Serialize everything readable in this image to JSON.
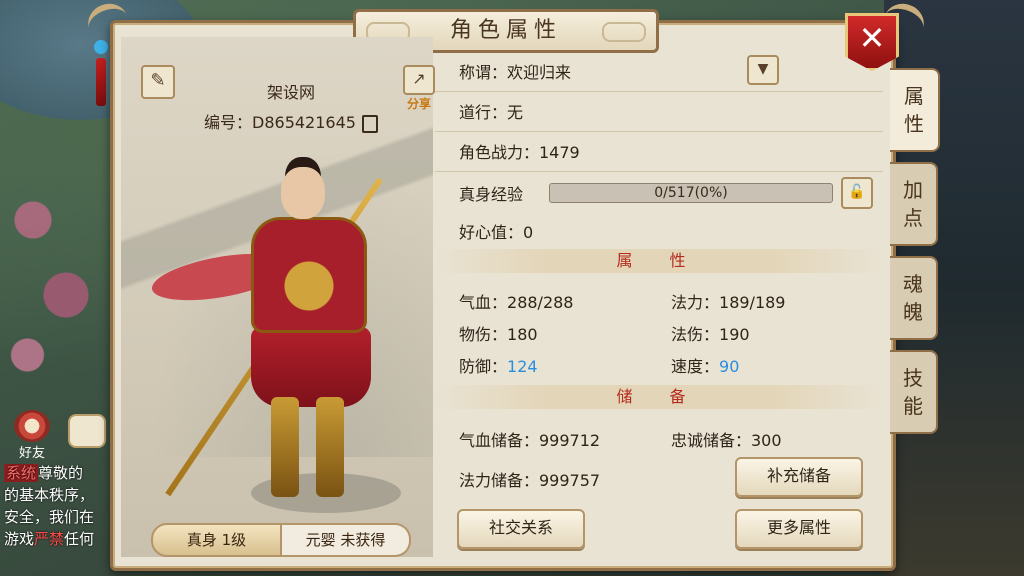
{
  "window": {
    "title": "角色属性"
  },
  "character": {
    "name": "架设网",
    "id_label": "编号：D865421645",
    "share_label": "分享",
    "realm_tabs": [
      {
        "label": "真身 1级",
        "active": true
      },
      {
        "label": "元婴 未获得",
        "active": false
      }
    ]
  },
  "info": {
    "title_row": "称谓：欢迎归来",
    "daoxing_row": "道行：无",
    "power_row": "角色战力：1479",
    "exp_label": "真身经验",
    "exp_text": "0/517(0%)",
    "exp_fraction": 0,
    "goodwill_row": "好心值：0"
  },
  "attributes": {
    "section_label": "属 性",
    "hp_label": "气血：",
    "hp_value": "288/288",
    "mp_label": "法力：",
    "mp_value": "189/189",
    "patk_label": "物伤：",
    "patk_value": "180",
    "matk_label": "法伤：",
    "matk_value": "190",
    "def_label": "防御：",
    "def_value": "124",
    "spd_label": "速度：",
    "spd_value": "90"
  },
  "reserves": {
    "section_label": "储 备",
    "hp_reserve": "气血储备：999712",
    "loyalty_reserve": "忠诚储备：300",
    "mp_reserve": "法力储备：999757",
    "refill_button": "补充储备"
  },
  "buttons": {
    "social": "社交关系",
    "more_attrs": "更多属性"
  },
  "side_tabs": [
    {
      "label_a": "属",
      "label_b": "性",
      "active": true
    },
    {
      "label_a": "加",
      "label_b": "点",
      "active": false
    },
    {
      "label_a": "魂",
      "label_b": "魄",
      "active": false
    },
    {
      "label_a": "技",
      "label_b": "能",
      "active": false
    }
  ],
  "chat": {
    "friend_label": "好友",
    "tag": "系统",
    "line1": "尊敬的",
    "line2": "的基本秩序，",
    "line3": "安全，我们在",
    "line4a": "游戏",
    "line4b": "严禁",
    "line4c": "任何"
  },
  "icons": {
    "close": "close-icon",
    "edit": "pencil-icon",
    "share": "share-icon",
    "copy": "copy-icon",
    "dropdown": "chevron-down-icon",
    "lock": "lock-icon"
  },
  "colors": {
    "accent_red": "#b62a1f",
    "value_blue": "#2a8ee0",
    "panel_bg": "#e9e3d4"
  }
}
